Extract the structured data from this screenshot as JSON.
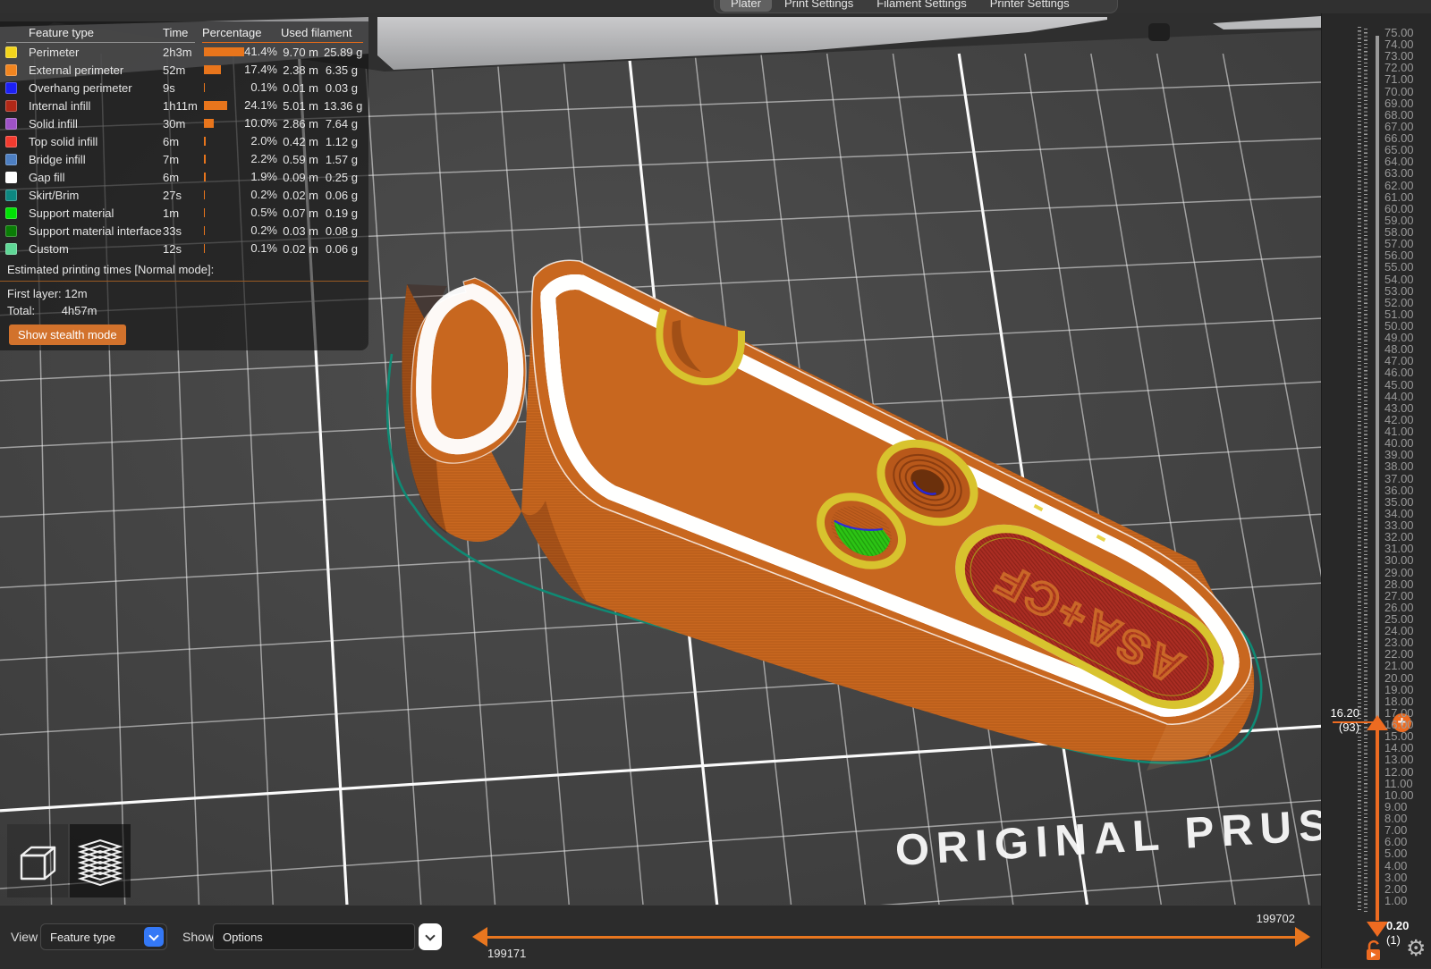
{
  "tabs": {
    "items": [
      {
        "label": "Plater",
        "selected": true
      },
      {
        "label": "Print Settings",
        "selected": false
      },
      {
        "label": "Filament Settings",
        "selected": false
      },
      {
        "label": "Printer Settings",
        "selected": false
      }
    ]
  },
  "legend": {
    "headers": {
      "feature_type": "Feature type",
      "time": "Time",
      "percentage": "Percentage",
      "used_filament": "Used filament"
    },
    "rows": [
      {
        "label": "Perimeter",
        "color": "#f2d41c",
        "time": "2h3m",
        "percent": 41.4,
        "percent_label": "41.4%",
        "length": "9.70 m",
        "weight": "25.89 g"
      },
      {
        "label": "External perimeter",
        "color": "#f1851f",
        "time": "52m",
        "percent": 17.4,
        "percent_label": "17.4%",
        "length": "2.38 m",
        "weight": "6.35 g"
      },
      {
        "label": "Overhang perimeter",
        "color": "#1c20f5",
        "time": "9s",
        "percent": 0.1,
        "percent_label": "0.1%",
        "length": "0.01 m",
        "weight": "0.03 g"
      },
      {
        "label": "Internal infill",
        "color": "#b02817",
        "time": "1h11m",
        "percent": 24.1,
        "percent_label": "24.1%",
        "length": "5.01 m",
        "weight": "13.36 g"
      },
      {
        "label": "Solid infill",
        "color": "#9e52c6",
        "time": "30m",
        "percent": 10.0,
        "percent_label": "10.0%",
        "length": "2.86 m",
        "weight": "7.64 g"
      },
      {
        "label": "Top solid infill",
        "color": "#f23b2f",
        "time": "6m",
        "percent": 2.0,
        "percent_label": "2.0%",
        "length": "0.42 m",
        "weight": "1.12 g"
      },
      {
        "label": "Bridge infill",
        "color": "#4d7fc2",
        "time": "7m",
        "percent": 2.2,
        "percent_label": "2.2%",
        "length": "0.59 m",
        "weight": "1.57 g"
      },
      {
        "label": "Gap fill",
        "color": "#ffffff",
        "time": "6m",
        "percent": 1.9,
        "percent_label": "1.9%",
        "length": "0.09 m",
        "weight": "0.25 g"
      },
      {
        "label": "Skirt/Brim",
        "color": "#0d8780",
        "time": "27s",
        "percent": 0.2,
        "percent_label": "0.2%",
        "length": "0.02 m",
        "weight": "0.06 g"
      },
      {
        "label": "Support material",
        "color": "#00e204",
        "time": "1m",
        "percent": 0.5,
        "percent_label": "0.5%",
        "length": "0.07 m",
        "weight": "0.19 g"
      },
      {
        "label": "Support material interface",
        "color": "#0a7d06",
        "time": "33s",
        "percent": 0.2,
        "percent_label": "0.2%",
        "length": "0.03 m",
        "weight": "0.08 g"
      },
      {
        "label": "Custom",
        "color": "#5fd796",
        "time": "12s",
        "percent": 0.1,
        "percent_label": "0.1%",
        "length": "0.02 m",
        "weight": "0.06 g"
      }
    ],
    "estimated_title": "Estimated printing times [Normal mode]:",
    "first_layer": "First layer: 12m",
    "total_label": "Total:",
    "total_value": "4h57m",
    "stealth_button": "Show stealth mode",
    "bar_color": "#e8751c"
  },
  "scene": {
    "bed_brand_text": "ORIGINAL PRUSA",
    "model_embossed_text": "ASA+CF",
    "skirt_color": "#0f8a74"
  },
  "right_slider": {
    "accent": "#ed6b21",
    "current_value": "16.20",
    "current_layer": "(93)",
    "min_value": "0.20",
    "min_layer": "(1)",
    "labels": [
      "75.00",
      "74.00",
      "73.00",
      "72.00",
      "71.00",
      "70.00",
      "69.00",
      "68.00",
      "67.00",
      "66.00",
      "65.00",
      "64.00",
      "63.00",
      "62.00",
      "61.00",
      "60.00",
      "59.00",
      "58.00",
      "57.00",
      "56.00",
      "55.00",
      "54.00",
      "53.00",
      "52.00",
      "51.00",
      "50.00",
      "49.00",
      "48.00",
      "47.00",
      "46.00",
      "45.00",
      "44.00",
      "43.00",
      "42.00",
      "41.00",
      "40.00",
      "39.00",
      "38.00",
      "37.00",
      "36.00",
      "35.00",
      "34.00",
      "33.00",
      "32.00",
      "31.00",
      "30.00",
      "29.00",
      "28.00",
      "27.00",
      "26.00",
      "25.00",
      "24.00",
      "23.00",
      "22.00",
      "21.00",
      "20.00",
      "19.00",
      "18.00",
      "17.00",
      "16.00",
      "15.00",
      "14.00",
      "13.00",
      "12.00",
      "11.00",
      "10.00",
      "9.00",
      "8.00",
      "7.00",
      "6.00",
      "5.00",
      "4.00",
      "3.00",
      "2.00",
      "1.00"
    ]
  },
  "bottom_bar": {
    "view_label": "View",
    "view_value": "Feature type",
    "show_label": "Show",
    "show_value": "Options",
    "range_start": "199171",
    "range_end": "199702"
  }
}
